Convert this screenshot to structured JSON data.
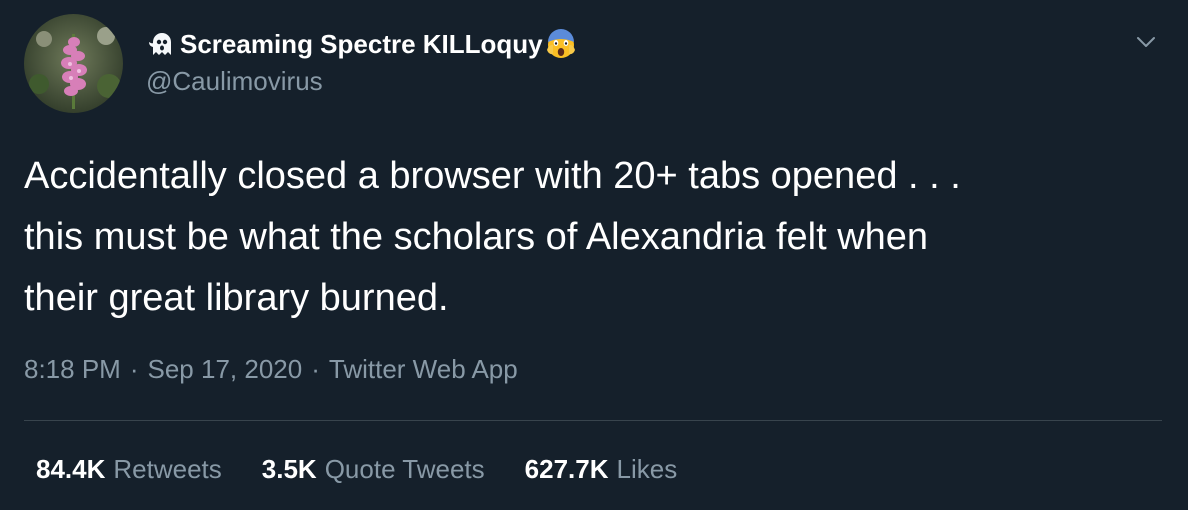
{
  "author": {
    "display_name": "Screaming Spectre KILLoquy",
    "handle": "@Caulimovirus",
    "prefix_emoji": "ghost-emoji",
    "suffix_emoji": "screaming-face-emoji"
  },
  "tweet": {
    "text": "Accidentally closed a browser with 20+ tabs opened . . .\nthis must be what the scholars of Alexandria felt when\ntheir great library burned."
  },
  "meta": {
    "time": "8:18 PM",
    "separator": "·",
    "date": "Sep 17, 2020",
    "source": "Twitter Web App"
  },
  "stats": {
    "retweets": {
      "count": "84.4K",
      "label": "Retweets"
    },
    "quote_tweets": {
      "count": "3.5K",
      "label": "Quote Tweets"
    },
    "likes": {
      "count": "627.7K",
      "label": "Likes"
    }
  },
  "theme": {
    "background": "#15202b",
    "text": "#ffffff",
    "secondary_text": "#8899a6",
    "divider": "#38444d"
  }
}
